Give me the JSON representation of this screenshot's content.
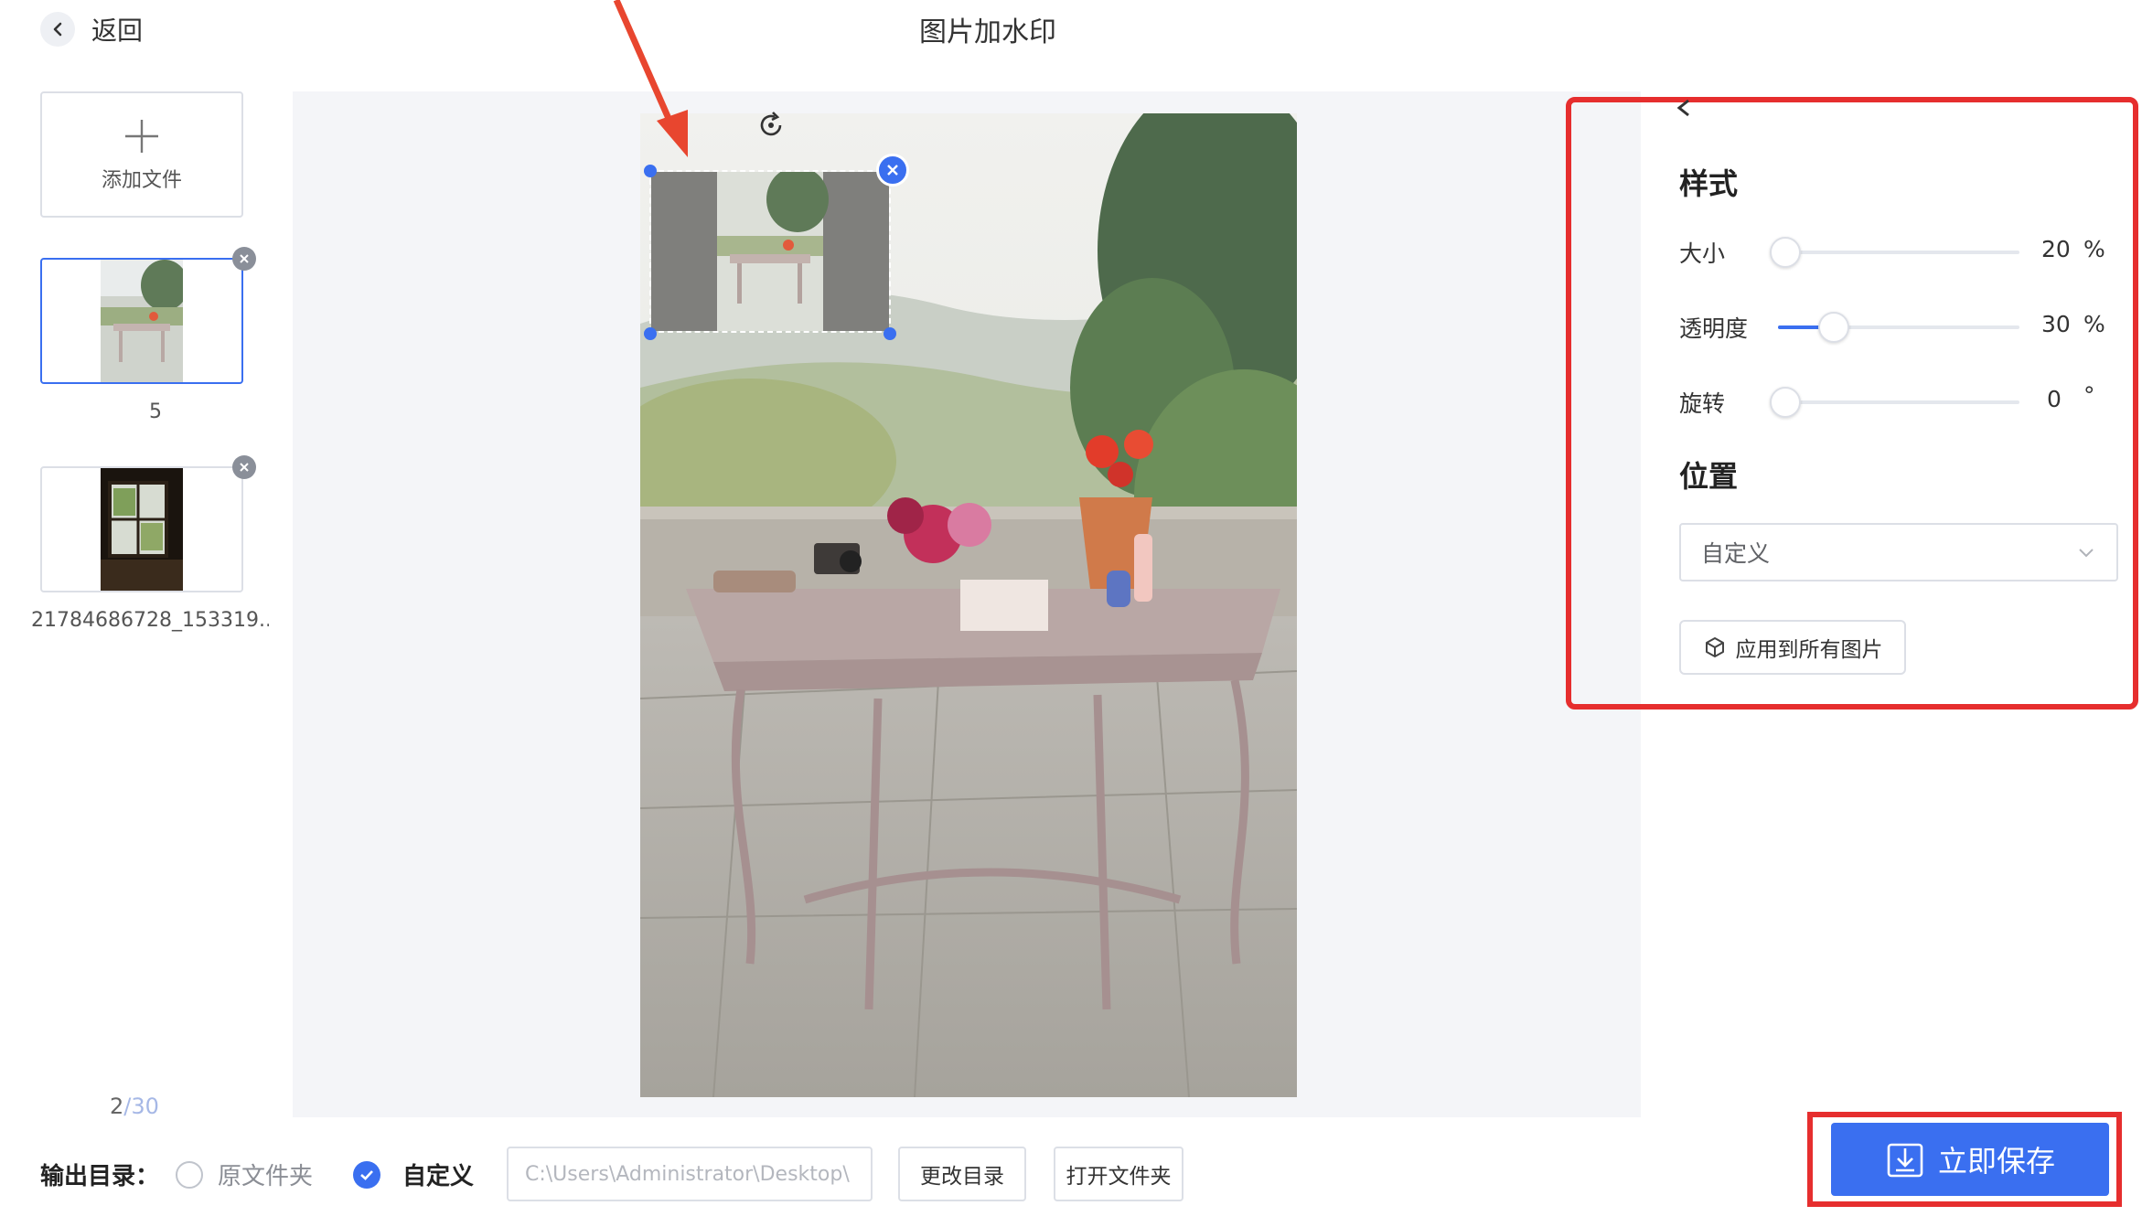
{
  "header": {
    "back_label": "返回",
    "title": "图片加水印"
  },
  "files": {
    "add_label": "添加文件",
    "items": [
      {
        "caption": "5",
        "active": true
      },
      {
        "caption": "21784686728_153319...",
        "active": false
      }
    ],
    "counter_current": "2",
    "counter_total": "/30"
  },
  "panel": {
    "style_title": "样式",
    "size": {
      "label": "大小",
      "value": "20",
      "unit": "%",
      "fraction": 0.0
    },
    "opacity": {
      "label": "透明度",
      "value": "30",
      "unit": "%",
      "fraction": 0.2
    },
    "rotation": {
      "label": "旋转",
      "value": "0",
      "unit": "°",
      "fraction": 0.0
    },
    "position_title": "位置",
    "position_value": "自定义",
    "apply_label": "应用到所有图片"
  },
  "footer": {
    "output_label": "输出目录：",
    "option_original": "原文件夹",
    "option_custom": "自定义",
    "path_value": "C:\\Users\\Administrator\\Desktop\\",
    "change_dir_label": "更改目录",
    "open_folder_label": "打开文件夹",
    "save_label": "立即保存"
  },
  "colors": {
    "accent": "#3a6ff0",
    "highlight": "#e62e2e",
    "arrow": "#e8462f"
  }
}
